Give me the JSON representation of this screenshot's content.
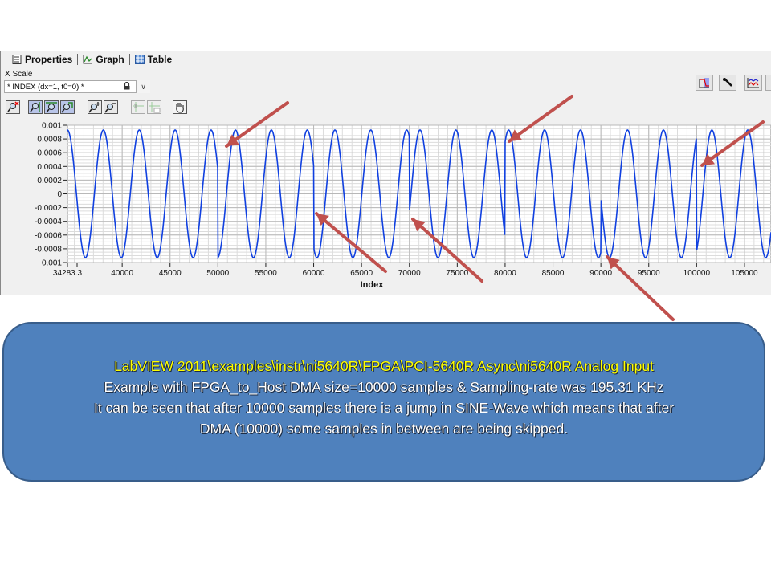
{
  "tabs": [
    {
      "label": "Properties",
      "icon": "properties-icon"
    },
    {
      "label": "Graph",
      "icon": "graph-icon"
    },
    {
      "label": "Table",
      "icon": "table-icon"
    }
  ],
  "x_scale": {
    "label": "X Scale",
    "selected": "* INDEX (dx=1, t0=0) *"
  },
  "toolbar": {
    "left_tools": [
      "zoom-reset-icon",
      "zoom-x-icon",
      "zoom-y-icon",
      "zoom-box-icon",
      "zoom-in-icon",
      "zoom-out-icon",
      "cursor-move-icon",
      "cursor-label-icon",
      "pan-hand-icon"
    ],
    "right_tools": [
      "plot-legend-icon",
      "wrench-icon",
      "plot-style-icon"
    ]
  },
  "chart_data": {
    "type": "line",
    "title": "",
    "xlabel": "Index",
    "ylabel": "",
    "xlim": [
      34283.3,
      110000
    ],
    "ylim": [
      -0.001,
      0.001
    ],
    "x_ticks": [
      "34283.3",
      "40000",
      "45000",
      "50000",
      "55000",
      "60000",
      "65000",
      "70000",
      "75000",
      "80000",
      "85000",
      "90000",
      "95000",
      "100000",
      "105000"
    ],
    "y_ticks": [
      "0.001",
      "0.0008",
      "0.0006",
      "0.0004",
      "0.0002",
      "0",
      "-0.0002",
      "-0.0004",
      "-0.0006",
      "-0.0008",
      "-0.001"
    ],
    "grid": true,
    "series": [
      {
        "name": "Analog Input",
        "color": "#1040e0",
        "amplitude": 0.00093,
        "period_samples": 3750,
        "block_size": 10000,
        "discontinuities_at": [
          50000,
          60000,
          70000,
          80000,
          90000,
          100000
        ]
      }
    ]
  },
  "annotations": {
    "arrow_color": "#c0504d",
    "arrow_targets_x": [
      50000,
      60000,
      70000,
      80000,
      90000,
      100000
    ]
  },
  "callout": {
    "line1": "LabVIEW 2011\\examples\\instr\\ni5640R\\FPGA\\PCI-5640R  Async\\ni5640R Analog Input",
    "line2": "Example  with FPGA_to_Host DMA size=10000 samples & Sampling-rate was 195.31 KHz",
    "line3": "It can be seen that  after 10000 samples there is a jump in SINE-Wave which means that after",
    "line4": "DMA (10000) some samples in between are being skipped.",
    "fill": "#4f81bd",
    "line1_color": "#ffff00"
  }
}
